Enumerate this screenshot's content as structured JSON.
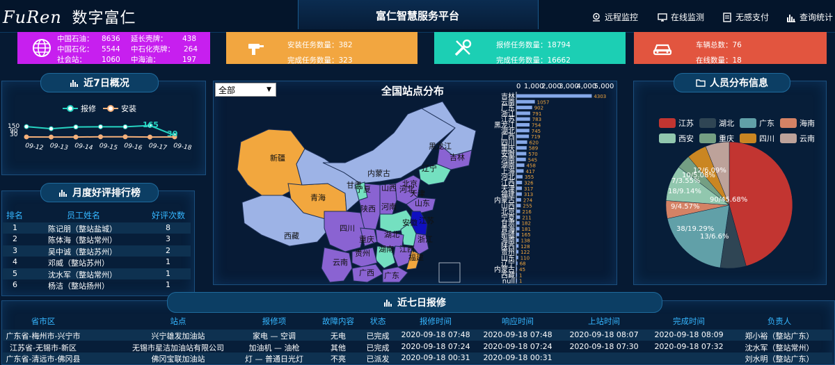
{
  "header": {
    "logo": "FuRen",
    "logo_cn": "数字富仁",
    "title": "富仁智慧服务平台",
    "nav": [
      {
        "label": "远程监控",
        "icon": "location-icon"
      },
      {
        "label": "在线监测",
        "icon": "monitor-icon"
      },
      {
        "label": "无感支付",
        "icon": "receipt-icon"
      },
      {
        "label": "查询统计",
        "icon": "bar-chart-icon"
      }
    ]
  },
  "cards": [
    {
      "icon": "globe-icon",
      "color": "#c71fef",
      "rows": [
        [
          "中国石油：",
          "8636",
          "延长壳牌：",
          "438"
        ],
        [
          "中国石化：",
          "5544",
          "中石化壳牌：",
          "264"
        ],
        [
          "社会站：",
          "1060",
          "中海油：",
          "197"
        ]
      ]
    },
    {
      "icon": "drill-icon",
      "color": "#f2a640",
      "lines": [
        "安装任务数量：382",
        "完成任务数量：323"
      ]
    },
    {
      "icon": "tools-icon",
      "color": "#1ccfb4",
      "lines": [
        "报修任务数量：18794",
        "完成任务数量：16662"
      ]
    },
    {
      "icon": "car-icon",
      "color": "#e2553f",
      "lines": [
        "车辆总数：76",
        "在线数量：18"
      ]
    }
  ],
  "overview": {
    "title": "近7日概况",
    "legend": [
      "报修",
      "安装"
    ],
    "y_ticks": [
      "150",
      "90",
      "30"
    ],
    "label_repair": "165",
    "label_install": "30",
    "colors": {
      "repair": "#26d4c2",
      "install": "#f5b07a"
    }
  },
  "ranking": {
    "title": "月度好评排行榜",
    "headers": [
      "排名",
      "员工姓名",
      "好评次数"
    ],
    "rows": [
      [
        "1",
        "陈记朋（整站盐城）",
        "8"
      ],
      [
        "2",
        "陈体海（整站常州）",
        "3"
      ],
      [
        "3",
        "吴中诚（整站苏州）",
        "2"
      ],
      [
        "4",
        "邓威（整站苏州）",
        "1"
      ],
      [
        "5",
        "沈水军（整站常州）",
        "1"
      ],
      [
        "6",
        "杨洁（整站扬州）",
        "1"
      ]
    ]
  },
  "map": {
    "title": "全国站点分布",
    "select": "全部",
    "provinces": [
      "黑龙江",
      "吉林",
      "辽宁",
      "内蒙古",
      "新疆",
      "西藏",
      "青海",
      "甘肃",
      "宁夏",
      "陕西",
      "山西",
      "河北",
      "山东",
      "河南",
      "江苏",
      "安徽",
      "四川",
      "重庆",
      "湖北",
      "湖南",
      "江西",
      "浙江",
      "贵州",
      "云南",
      "广西",
      "广东",
      "福建",
      "北京",
      "天津"
    ]
  },
  "person": {
    "title": "人员分布信息",
    "legend": [
      "江苏",
      "湖北",
      "广东",
      "海南",
      "西安",
      "重庆",
      "四川",
      "云南"
    ],
    "labels": [
      "90/45.68%",
      "13/6.6%",
      "38/19.29%",
      "9/4.57%",
      "18/9.14%",
      "7/3.55%",
      "10/5.08%",
      "12/6.09%"
    ]
  },
  "repairs": {
    "title": "近七日报修",
    "headers": [
      "省市区",
      "站点",
      "报修项",
      "故障内容",
      "状态",
      "报修时间",
      "响应时间",
      "上站时间",
      "完成时间",
      "负责人"
    ],
    "rows": [
      [
        "广东省-梅州市-兴宁市",
        "兴宁雄发加油站",
        "家电 — 空调",
        "无电",
        "已完成",
        "2020-09-18 07:48",
        "2020-09-18 07:48",
        "2020-09-18 08:07",
        "2020-09-18 08:09",
        "郑小裕（整站广东）"
      ],
      [
        "江苏省-无锡市-新区",
        "无锡市星洁加油站有限公司",
        "加油机 — 油枪",
        "其他",
        "已完成",
        "2020-09-18 07:24",
        "2020-09-18 07:24",
        "2020-09-18 07:30",
        "2020-09-18 07:32",
        "沈水军（整站常州）"
      ],
      [
        "广东省-清远市-佛冈县",
        "佛冈宝联加油站",
        "灯 — 普通日光灯",
        "不亮",
        "已派发",
        "2020-09-18 00:31",
        "2020-09-18 00:31",
        "",
        "",
        "刘水明（整站广东）"
      ]
    ]
  },
  "chart_data": [
    {
      "type": "line",
      "title": "近7日概况",
      "x": [
        "09-12",
        "09-13",
        "09-14",
        "09-15",
        "09-16",
        "09-17",
        "09-18"
      ],
      "series": [
        {
          "name": "报修",
          "values": [
            150,
            122,
            145,
            148,
            147,
            165,
            30
          ]
        },
        {
          "name": "安装",
          "values": [
            10,
            8,
            8,
            12,
            12,
            8,
            10
          ]
        }
      ],
      "ylim": [
        0,
        170
      ]
    },
    {
      "type": "bar",
      "title": "",
      "categories": [
        "吉林",
        "云南",
        "广东",
        "浙江",
        "江苏",
        "黑龙江",
        "湖北",
        "广西",
        "四川",
        "重庆",
        "安徽",
        "河南",
        "湖南",
        "上海",
        "河北",
        "江西",
        "天津",
        "福建",
        "内蒙古",
        "山西",
        "北京",
        "宁夏",
        "甘肃",
        "青海",
        "新疆",
        "海南",
        "陕西",
        "贵州",
        "山东",
        "辽宁",
        "内蒙古",
        "西藏",
        "null"
      ],
      "values": [
        4303,
        1057,
        902,
        791,
        783,
        754,
        745,
        719,
        620,
        589,
        570,
        545,
        458,
        417,
        355,
        326,
        317,
        313,
        274,
        255,
        216,
        211,
        182,
        181,
        165,
        138,
        128,
        122,
        110,
        68,
        45,
        1,
        1
      ],
      "x_ticks": [
        "0",
        "1,000",
        "2,000",
        "3,000",
        "4,000",
        "5,000"
      ],
      "xlim": [
        0,
        5000
      ]
    },
    {
      "type": "pie",
      "title": "人员分布信息",
      "categories": [
        "江苏",
        "湖北",
        "广东",
        "海南",
        "西安",
        "重庆",
        "四川",
        "云南"
      ],
      "values": [
        90,
        13,
        38,
        9,
        18,
        7,
        10,
        12
      ],
      "colors": [
        "#c23531",
        "#2f4554",
        "#61a0a8",
        "#d48265",
        "#91c7ae",
        "#749f83",
        "#ca8622",
        "#bda29a"
      ]
    }
  ]
}
